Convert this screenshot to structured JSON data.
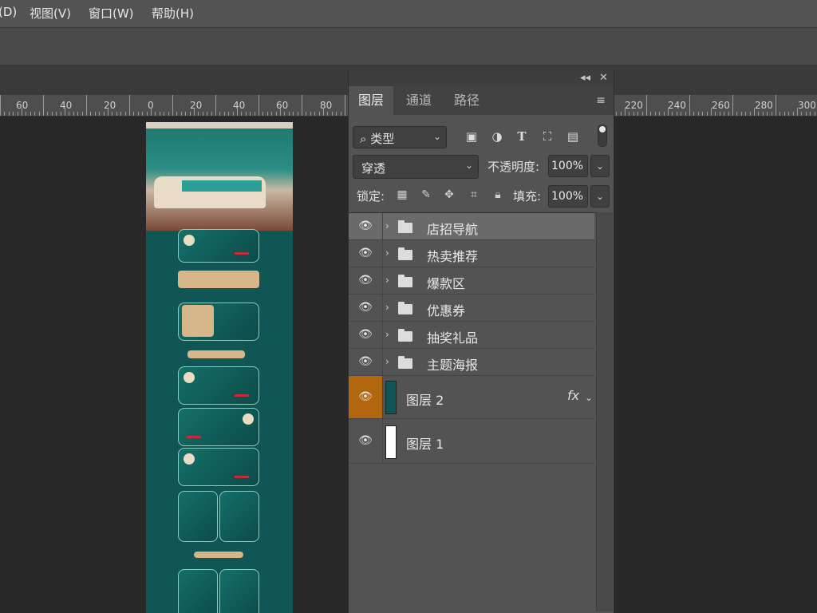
{
  "menubar": {
    "items": [
      {
        "label": "(D)"
      },
      {
        "label": "视图(V)"
      },
      {
        "label": "窗口(W)"
      },
      {
        "label": "帮助(H)"
      }
    ]
  },
  "ruler": {
    "labels": [
      "60",
      "40",
      "20",
      "0",
      "20",
      "40",
      "60",
      "80",
      "220",
      "240",
      "260",
      "280",
      "300"
    ]
  },
  "layers_panel": {
    "collapse_icon": "◂◂",
    "close_icon": "✕",
    "tabs": [
      {
        "label": "图层",
        "active": true
      },
      {
        "label": "通道",
        "active": false
      },
      {
        "label": "路径",
        "active": false
      }
    ],
    "menu_icon": "≡",
    "filter": {
      "label": "类型",
      "search_icon": "⌕",
      "icons": [
        "image-filter-icon",
        "adjustment-filter-icon",
        "type-filter-icon",
        "shape-filter-icon",
        "smartobject-filter-icon"
      ]
    },
    "blend_mode": "穿透",
    "opacity_label": "不透明度:",
    "opacity_value": "100%",
    "lock_label": "锁定:",
    "fill_label": "填充:",
    "fill_value": "100%",
    "layers": [
      {
        "name": "店招导航",
        "type": "group",
        "selected": true
      },
      {
        "name": "热卖推荐",
        "type": "group",
        "selected": false
      },
      {
        "name": "爆款区",
        "type": "group",
        "selected": false
      },
      {
        "name": "优惠券",
        "type": "group",
        "selected": false
      },
      {
        "name": "抽奖礼品",
        "type": "group",
        "selected": false
      },
      {
        "name": "主题海报",
        "type": "group",
        "selected": false
      },
      {
        "name": "图层 2",
        "type": "layer",
        "thumb_color": "#0f5654",
        "fx": "fx",
        "active_eye": true
      },
      {
        "name": "图层 1",
        "type": "layer",
        "thumb_color": "#ffffff",
        "fx": "",
        "active_eye": false
      }
    ]
  },
  "colors": {
    "accent_eye": "#b1670d",
    "canvas_teal": "#0f5654"
  }
}
